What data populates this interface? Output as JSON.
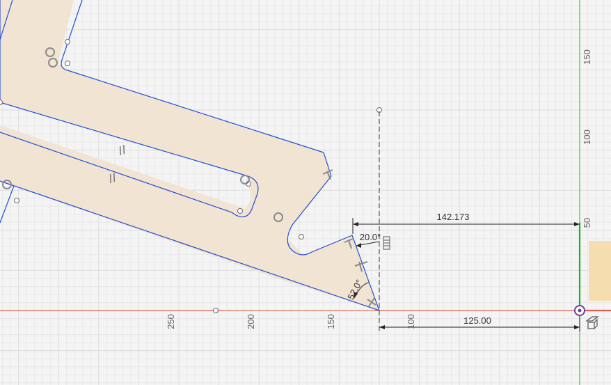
{
  "app": "sketch-canvas",
  "colors": {
    "background": "#f4f4f4",
    "grid_minor": "#e8e8e8",
    "grid_major": "#dcdcdc",
    "profile_fill": "#f2e4d2",
    "sketch_line": "#1f4fd8",
    "construction_line": "#555555",
    "dimension_line": "#222222",
    "x_axis": "#e05a4e",
    "y_axis": "#4cc24c",
    "orange_block": "#f6ddb0"
  },
  "ruler": {
    "horizontal_labels": [
      "250",
      "200",
      "150",
      "100"
    ],
    "vertical_labels": [
      "150",
      "100",
      "50"
    ]
  },
  "dimensions": {
    "horizontal_top": "142.173",
    "horizontal_bottom": "125.00",
    "angle_top": "20.0°",
    "angle_bottom": "52.0°"
  },
  "constraints": {
    "parallel_symbol": "//",
    "fix_symbol": "≡"
  },
  "icons": {
    "origin": "origin-icon",
    "view_cube": "view-cube-icon"
  }
}
